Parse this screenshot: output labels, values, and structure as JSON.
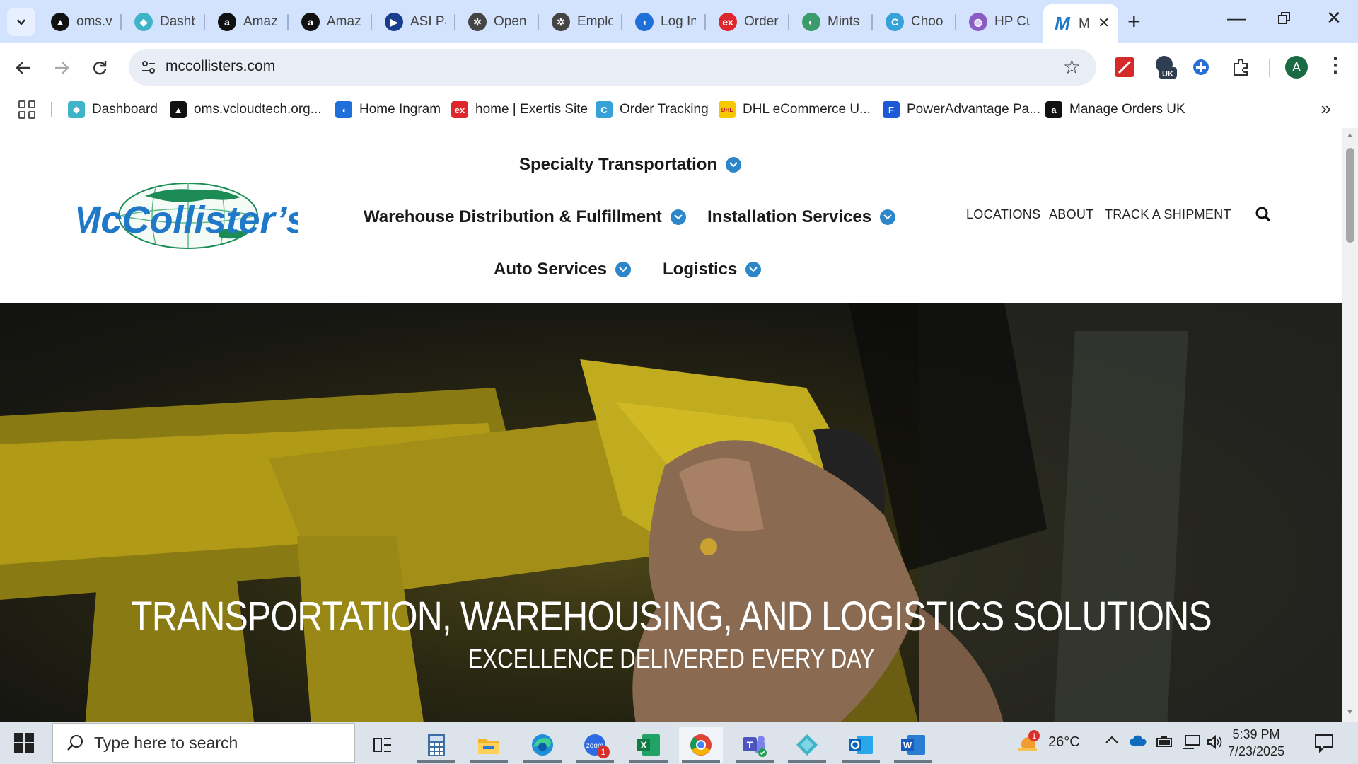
{
  "browser": {
    "tabs": [
      {
        "title": "oms.v",
        "color": "#111111",
        "glyph": "▲"
      },
      {
        "title": "Dashb",
        "color": "#3fb3c7",
        "glyph": "◆"
      },
      {
        "title": "Amaz",
        "color": "#111111",
        "glyph": "a"
      },
      {
        "title": "Amaz",
        "color": "#111111",
        "glyph": "a"
      },
      {
        "title": "ASI Pa",
        "color": "#1b3d8f",
        "glyph": "▶"
      },
      {
        "title": "Open",
        "color": "#444444",
        "glyph": "✲"
      },
      {
        "title": "Emplo",
        "color": "#444444",
        "glyph": "✲"
      },
      {
        "title": "Log In",
        "color": "#1e6fd9",
        "glyph": "◖"
      },
      {
        "title": "Order",
        "color": "#e0262d",
        "glyph": "ex"
      },
      {
        "title": "Mints",
        "color": "#3a9b6b",
        "glyph": "◐"
      },
      {
        "title": "Choo",
        "color": "#36a2d8",
        "glyph": "C"
      },
      {
        "title": "HP Cu",
        "color": "#8a5cc4",
        "glyph": "◍"
      }
    ],
    "active_tab": {
      "title": "M",
      "glyph": "M"
    },
    "url": "mccollisters.com",
    "bookmarks": [
      {
        "label": "Dashboard",
        "color": "#3fb3c7",
        "glyph": "◆"
      },
      {
        "label": "oms.vcloudtech.org...",
        "color": "#111111",
        "glyph": "▲"
      },
      {
        "label": "Home Ingram",
        "color": "#1e6fd9",
        "glyph": "◖"
      },
      {
        "label": "home | Exertis Site",
        "color": "#e0262d",
        "glyph": "ex"
      },
      {
        "label": "Order Tracking",
        "color": "#36a2d8",
        "glyph": "C"
      },
      {
        "label": "DHL eCommerce U...",
        "color": "#f6c800",
        "glyph": "DHL"
      },
      {
        "label": "PowerAdvantage Pa...",
        "color": "#1e5ad6",
        "glyph": "F"
      },
      {
        "label": "Manage Orders UK",
        "color": "#111111",
        "glyph": "a"
      }
    ],
    "profile_initial": "A",
    "ext_badge": "UK"
  },
  "site": {
    "logo_text": "McCollister’s",
    "menu": {
      "specialty": "Specialty Transportation",
      "warehouse": "Warehouse Distribution & Fulfillment",
      "installation": "Installation Services",
      "auto": "Auto Services",
      "logistics": "Logistics"
    },
    "utility": {
      "locations": "LOCATIONS",
      "about": "ABOUT",
      "track": "TRACK A SHIPMENT"
    },
    "hero": {
      "title": "TRANSPORTATION, WAREHOUSING, AND LOGISTICS SOLUTIONS",
      "subtitle": "EXCELLENCE DELIVERED EVERY DAY"
    }
  },
  "taskbar": {
    "search_placeholder": "Type here to search",
    "weather": "26°C",
    "weather_badge": "1",
    "zoom_badge": "1",
    "time": "5:39 PM",
    "date": "7/23/2025"
  }
}
